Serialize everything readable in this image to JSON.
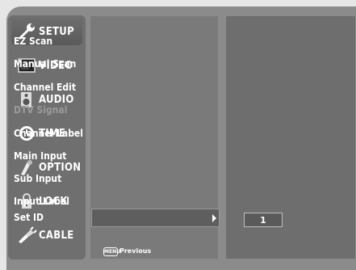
{
  "sidebar": {
    "tabs": [
      {
        "label": "SETUP",
        "icon": "wrench-icon",
        "active": true
      },
      {
        "label": "VIDEO",
        "icon": "screen-icon",
        "active": false
      },
      {
        "label": "AUDIO",
        "icon": "speaker-icon",
        "active": false
      },
      {
        "label": "TIME",
        "icon": "clock-icon",
        "active": false
      },
      {
        "label": "OPTION",
        "icon": "gear-icon",
        "active": false
      },
      {
        "label": "LOCK",
        "icon": "padlock-icon",
        "active": false
      },
      {
        "label": "CABLE",
        "icon": "plug-icon",
        "active": false
      }
    ]
  },
  "menu": {
    "items": [
      {
        "label": "EZ Scan"
      },
      {
        "label": "Manual Scan"
      },
      {
        "label": "Channel Edit"
      },
      {
        "label": "DTV Signal",
        "disabled": true
      },
      {
        "label": "Channel Label"
      },
      {
        "label": "Main Input"
      },
      {
        "label": "Sub Input"
      },
      {
        "label": "Input Label"
      },
      {
        "label": "Set ID",
        "highlighted": true
      }
    ],
    "set_id_value": "1"
  },
  "footer": {
    "menu_key": "MENU",
    "action": "Previous"
  },
  "colors": {
    "background": "#8b8b8b",
    "highlight": "#5e5e5e",
    "text": "#ffffff"
  }
}
